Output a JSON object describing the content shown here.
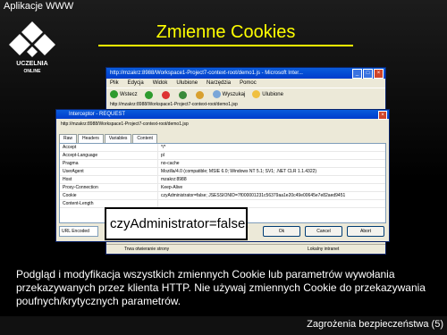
{
  "slide": {
    "top_label": "Aplikacje WWW",
    "logo_text_line1": "UCZELNIA",
    "logo_text_line2": "ONLINE",
    "title": "Zmienne Cookies",
    "description": "Podgląd i modyfikacja wszystkich zmiennych Cookie lub parametrów wywołania przekazywanych przez klienta HTTP. Nie używaj zmiennych Cookie do przekazywania poufnych/krytycznych parametrów.",
    "footer": "Zagrożenia bezpieczeństwa (5)"
  },
  "browser": {
    "title": "http://mzakrz:8988/Workspace1-Project7-context-root/demo1.js - Microsoft Inter...",
    "menu": [
      "Plik",
      "Edycja",
      "Widok",
      "Ulubione",
      "Narzędzia",
      "Pomoc"
    ],
    "toolbar": {
      "back": "Wstecz",
      "search": "Wyszukaj",
      "favorites": "Ulubione"
    },
    "address": "http://mzakrz:8988/Workspace1-Project7-context-root/demo1.jsp",
    "status_left": "Trwa otwieranie strony",
    "status_right": "Lokalny intranet"
  },
  "dialog": {
    "title": "Interceptor - REQUEST",
    "url": "http://mzakrz:8988/Workspace1-Project7-context-root/demo1.jsp",
    "tabs": [
      "Raw",
      "Headers",
      "Variables",
      "Content"
    ],
    "rows": [
      {
        "key": "Accept",
        "value": "*/*"
      },
      {
        "key": "Accept-Language",
        "value": "pl"
      },
      {
        "key": "Pragma",
        "value": "no-cache"
      },
      {
        "key": "UserAgent",
        "value": "Mozilla/4.0 (compatible; MSIE 6.0; Windows NT 5.1; SV1; .NET CLR 1.1.4322)"
      },
      {
        "key": "Host",
        "value": "mzakrz:8988"
      },
      {
        "key": "Proxy-Connection",
        "value": "Keep-Alive"
      },
      {
        "key": "Cookie",
        "value": "czyAdministrator=false; JSESSIONID=7f000001231c56379aa1e20c49e00645e7e82aed9451"
      },
      {
        "key": "Content-Length",
        "value": ""
      }
    ],
    "encoding": "URL Encoded",
    "ok": "Ok",
    "cancel": "Cancel",
    "abort": "Abort"
  },
  "zoom": {
    "text": "czyAdministrator=false;"
  }
}
